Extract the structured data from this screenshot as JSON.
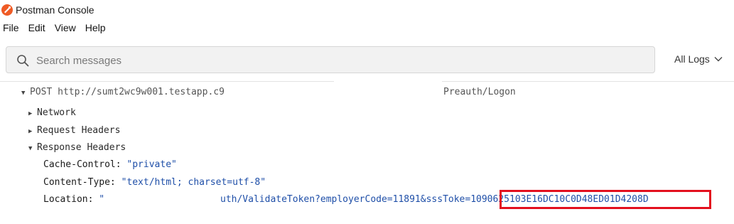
{
  "window": {
    "title": "Postman Console"
  },
  "menu": [
    "File",
    "Edit",
    "View",
    "Help"
  ],
  "search": {
    "placeholder": "Search messages"
  },
  "logs_filter": {
    "label": "All Logs"
  },
  "request": {
    "method": "POST",
    "url_start": "http://sumt2wc9w001.testapp.c9",
    "url_end": "Preauth/Logon"
  },
  "sections": {
    "network": "Network",
    "request_headers": "Request Headers",
    "response_headers": "Response Headers"
  },
  "headers": [
    {
      "key": "Cache-Control:",
      "value": "\"private\""
    },
    {
      "key": "Content-Type:",
      "value": "\"text/html; charset=utf-8\""
    },
    {
      "key": "Location:",
      "value_start": "\"",
      "value_mid": "uth/ValidateToken?employerCode=11891&sssToke",
      "value_token": "=1090625103E16DC10C0D48ED01D4208D"
    }
  ],
  "colors": {
    "accent_icon": "#ef5b25",
    "value_blue": "#1f4fa8",
    "highlight_red": "#e3101e"
  }
}
